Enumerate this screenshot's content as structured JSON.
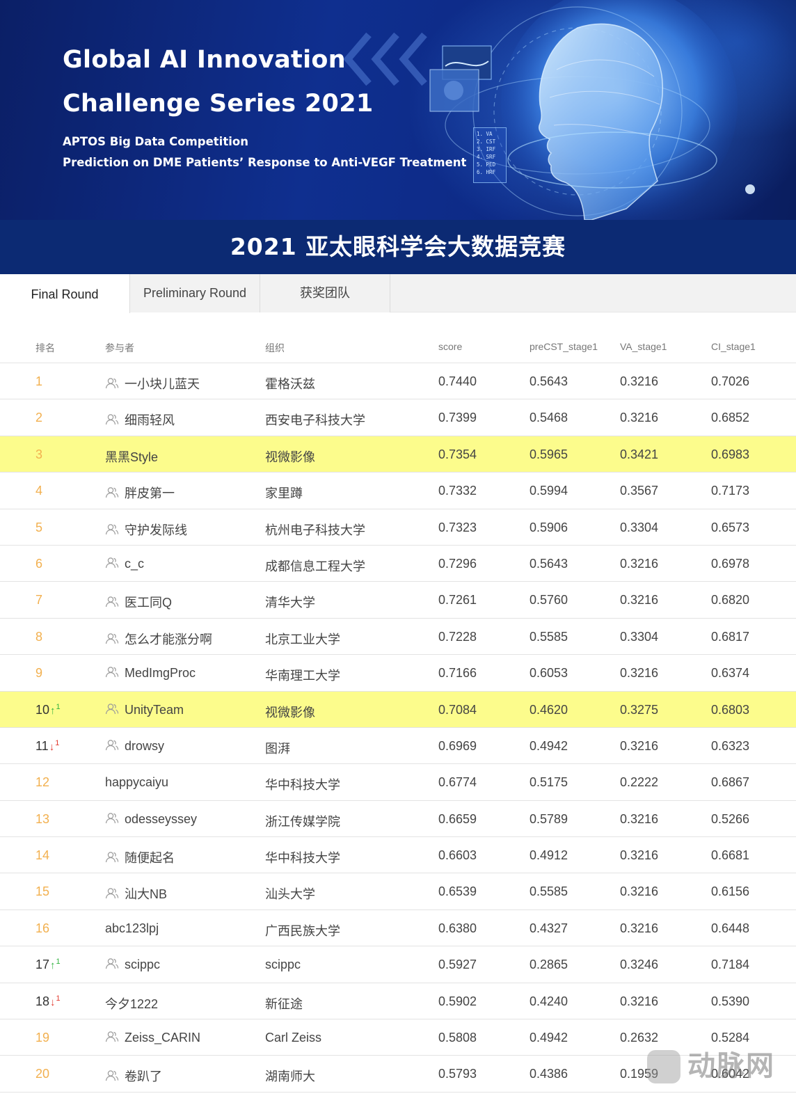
{
  "banner": {
    "title_line1": "Global AI Innovation",
    "title_line2": "Challenge Series 2021",
    "subtitle_line1": "APTOS Big Data Competition",
    "subtitle_line2": "Prediction on DME Patients’ Response to Anti-VEGF Treatment",
    "panel_lines": [
      "1. VA",
      "2. CST",
      "3. IRF",
      "4. SRF",
      "5. PED",
      "6. HRF"
    ]
  },
  "page_title": "2021 亚太眼科学会大数据竞赛",
  "tabs": [
    {
      "label": "Final Round",
      "active": true
    },
    {
      "label": "Preliminary Round",
      "active": false
    },
    {
      "label": "获奖团队",
      "active": false
    }
  ],
  "table": {
    "headers": {
      "rank": "排名",
      "participant": "参与者",
      "organization": "组织",
      "score": "score",
      "precst": "preCST_stage1",
      "va": "VA_stage1",
      "ci": "CI_stage1"
    },
    "rows": [
      {
        "rank": "1",
        "user": "一小块儿蓝天",
        "org": "霍格沃兹",
        "score": "0.7440",
        "precst": "0.5643",
        "va": "0.3216",
        "ci": "0.7026",
        "team": true,
        "highlight": false,
        "change": null,
        "delta": ""
      },
      {
        "rank": "2",
        "user": "细雨轻风",
        "org": "西安电子科技大学",
        "score": "0.7399",
        "precst": "0.5468",
        "va": "0.3216",
        "ci": "0.6852",
        "team": true,
        "highlight": false,
        "change": null,
        "delta": ""
      },
      {
        "rank": "3",
        "user": "黑黑Style",
        "org": "视微影像",
        "score": "0.7354",
        "precst": "0.5965",
        "va": "0.3421",
        "ci": "0.6983",
        "team": false,
        "highlight": true,
        "change": null,
        "delta": ""
      },
      {
        "rank": "4",
        "user": "胖皮第一",
        "org": "家里蹲",
        "score": "0.7332",
        "precst": "0.5994",
        "va": "0.3567",
        "ci": "0.7173",
        "team": true,
        "highlight": false,
        "change": null,
        "delta": ""
      },
      {
        "rank": "5",
        "user": "守护发际线",
        "org": "杭州电子科技大学",
        "score": "0.7323",
        "precst": "0.5906",
        "va": "0.3304",
        "ci": "0.6573",
        "team": true,
        "highlight": false,
        "change": null,
        "delta": ""
      },
      {
        "rank": "6",
        "user": "c_c",
        "org": "成都信息工程大学",
        "score": "0.7296",
        "precst": "0.5643",
        "va": "0.3216",
        "ci": "0.6978",
        "team": true,
        "highlight": false,
        "change": null,
        "delta": ""
      },
      {
        "rank": "7",
        "user": "医工同Q",
        "org": "清华大学",
        "score": "0.7261",
        "precst": "0.5760",
        "va": "0.3216",
        "ci": "0.6820",
        "team": true,
        "highlight": false,
        "change": null,
        "delta": ""
      },
      {
        "rank": "8",
        "user": "怎么才能涨分啊",
        "org": "北京工业大学",
        "score": "0.7228",
        "precst": "0.5585",
        "va": "0.3304",
        "ci": "0.6817",
        "team": true,
        "highlight": false,
        "change": null,
        "delta": ""
      },
      {
        "rank": "9",
        "user": "MedImgProc",
        "org": "华南理工大学",
        "score": "0.7166",
        "precst": "0.6053",
        "va": "0.3216",
        "ci": "0.6374",
        "team": true,
        "highlight": false,
        "change": null,
        "delta": ""
      },
      {
        "rank": "10",
        "user": "UnityTeam",
        "org": "视微影像",
        "score": "0.7084",
        "precst": "0.4620",
        "va": "0.3275",
        "ci": "0.6803",
        "team": true,
        "highlight": true,
        "change": "up",
        "delta": "1"
      },
      {
        "rank": "11",
        "user": "drowsy",
        "org": "图湃",
        "score": "0.6969",
        "precst": "0.4942",
        "va": "0.3216",
        "ci": "0.6323",
        "team": true,
        "highlight": false,
        "change": "down",
        "delta": "1"
      },
      {
        "rank": "12",
        "user": "happycaiyu",
        "org": "华中科技大学",
        "score": "0.6774",
        "precst": "0.5175",
        "va": "0.2222",
        "ci": "0.6867",
        "team": false,
        "highlight": false,
        "change": null,
        "delta": ""
      },
      {
        "rank": "13",
        "user": "odesseyssey",
        "org": "浙江传媒学院",
        "score": "0.6659",
        "precst": "0.5789",
        "va": "0.3216",
        "ci": "0.5266",
        "team": true,
        "highlight": false,
        "change": null,
        "delta": ""
      },
      {
        "rank": "14",
        "user": "随便起名",
        "org": "华中科技大学",
        "score": "0.6603",
        "precst": "0.4912",
        "va": "0.3216",
        "ci": "0.6681",
        "team": true,
        "highlight": false,
        "change": null,
        "delta": ""
      },
      {
        "rank": "15",
        "user": "汕大NB",
        "org": "汕头大学",
        "score": "0.6539",
        "precst": "0.5585",
        "va": "0.3216",
        "ci": "0.6156",
        "team": true,
        "highlight": false,
        "change": null,
        "delta": ""
      },
      {
        "rank": "16",
        "user": "abc123lpj",
        "org": "广西民族大学",
        "score": "0.6380",
        "precst": "0.4327",
        "va": "0.3216",
        "ci": "0.6448",
        "team": false,
        "highlight": false,
        "change": null,
        "delta": ""
      },
      {
        "rank": "17",
        "user": "scippc",
        "org": "scippc",
        "score": "0.5927",
        "precst": "0.2865",
        "va": "0.3246",
        "ci": "0.7184",
        "team": true,
        "highlight": false,
        "change": "up",
        "delta": "1"
      },
      {
        "rank": "18",
        "user": "今夕1222",
        "org": "新征途",
        "score": "0.5902",
        "precst": "0.4240",
        "va": "0.3216",
        "ci": "0.5390",
        "team": false,
        "highlight": false,
        "change": "down",
        "delta": "1"
      },
      {
        "rank": "19",
        "user": "Zeiss_CARIN",
        "org": "Carl Zeiss",
        "score": "0.5808",
        "precst": "0.4942",
        "va": "0.2632",
        "ci": "0.5284",
        "team": true,
        "highlight": false,
        "change": null,
        "delta": ""
      },
      {
        "rank": "20",
        "user": "卷趴了",
        "org": "湖南师大",
        "score": "0.5793",
        "precst": "0.4386",
        "va": "0.1959",
        "ci": "0.6042",
        "team": true,
        "highlight": false,
        "change": null,
        "delta": ""
      }
    ]
  },
  "watermark": {
    "text": "动脉网"
  },
  "colors": {
    "banner_dark": "#0b1f66",
    "titlebar": "#0c2a73",
    "rank_orange": "#f2b04f",
    "highlight": "#fcfc8c",
    "up_green": "#31b23f",
    "down_red": "#e23a2f"
  }
}
